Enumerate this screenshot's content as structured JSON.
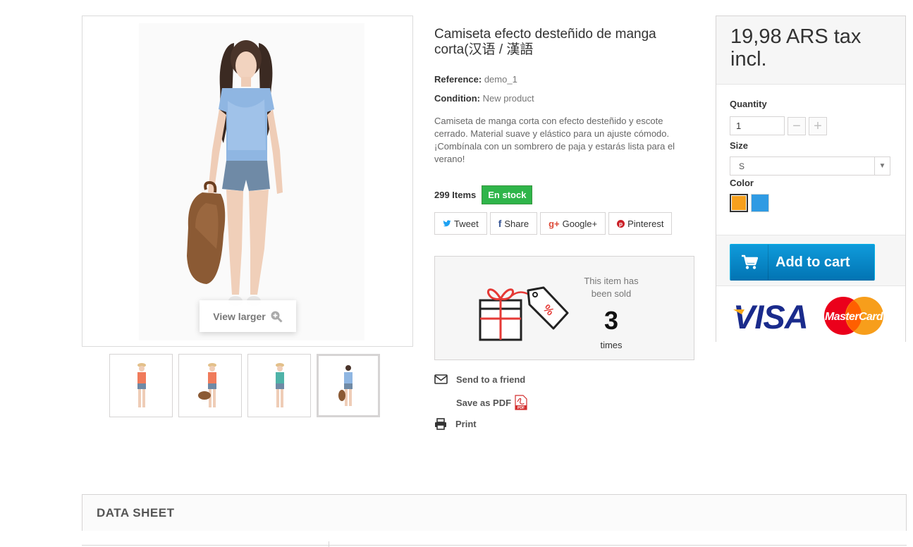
{
  "product": {
    "name": "Camiseta efecto desteñido de manga corta(汉语 / 漢語",
    "reference_label": "Reference:",
    "reference_value": "demo_1",
    "condition_label": "Condition:",
    "condition_value": "New product",
    "description": "Camiseta de manga corta con efecto desteñido y escote cerrado. Material suave y elástico para un ajuste cómodo. ¡Combínala con un sombrero de paja y estarás lista para el verano!",
    "items_count": "299 Items",
    "stock_status": "En stock"
  },
  "gallery": {
    "view_larger": "View larger",
    "thumbnails": [
      "thumb-1",
      "thumb-2",
      "thumb-3",
      "thumb-4"
    ],
    "active_thumbnail": 4
  },
  "social": {
    "tweet": "Tweet",
    "share": "Share",
    "google": "Google+",
    "pinterest": "Pinterest"
  },
  "sold": {
    "text": "This item has been sold",
    "count": "3",
    "unit": "times"
  },
  "actions": {
    "send_friend": "Send to a friend",
    "save_pdf": "Save as PDF",
    "print": "Print"
  },
  "buy": {
    "price": "19,98 ARS tax incl.",
    "quantity_label": "Quantity",
    "quantity_value": "1",
    "size_label": "Size",
    "size_value": "S",
    "color_label": "Color",
    "colors": [
      "#f7a01d",
      "#2f9be3"
    ],
    "add_to_cart": "Add to cart"
  },
  "payment": {
    "visa": "VISA",
    "mastercard": "MasterCard"
  },
  "tabs": {
    "data_sheet": "DATA SHEET"
  },
  "colors": {
    "accent_blue": "#0f9bdb",
    "stock_green": "#2fb54a"
  }
}
